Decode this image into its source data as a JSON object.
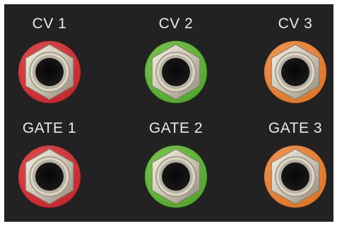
{
  "panel": {
    "background": "#222222"
  },
  "jacks": [
    {
      "label": "CV 1",
      "ring_color": "#c9282e",
      "ring_highlight": "#e0585a",
      "icon": "jack-socket-icon"
    },
    {
      "label": "CV 2",
      "ring_color": "#53a82b",
      "ring_highlight": "#84cc5c",
      "icon": "jack-socket-icon"
    },
    {
      "label": "CV 3",
      "ring_color": "#e0762a",
      "ring_highlight": "#f3a05c",
      "icon": "jack-socket-icon"
    },
    {
      "label": "GATE 1",
      "ring_color": "#c9282e",
      "ring_highlight": "#e0585a",
      "icon": "jack-socket-icon"
    },
    {
      "label": "GATE 2",
      "ring_color": "#53a82b",
      "ring_highlight": "#84cc5c",
      "icon": "jack-socket-icon"
    },
    {
      "label": "GATE 3",
      "ring_color": "#e0762a",
      "ring_highlight": "#f3a05c",
      "icon": "jack-socket-icon"
    }
  ]
}
